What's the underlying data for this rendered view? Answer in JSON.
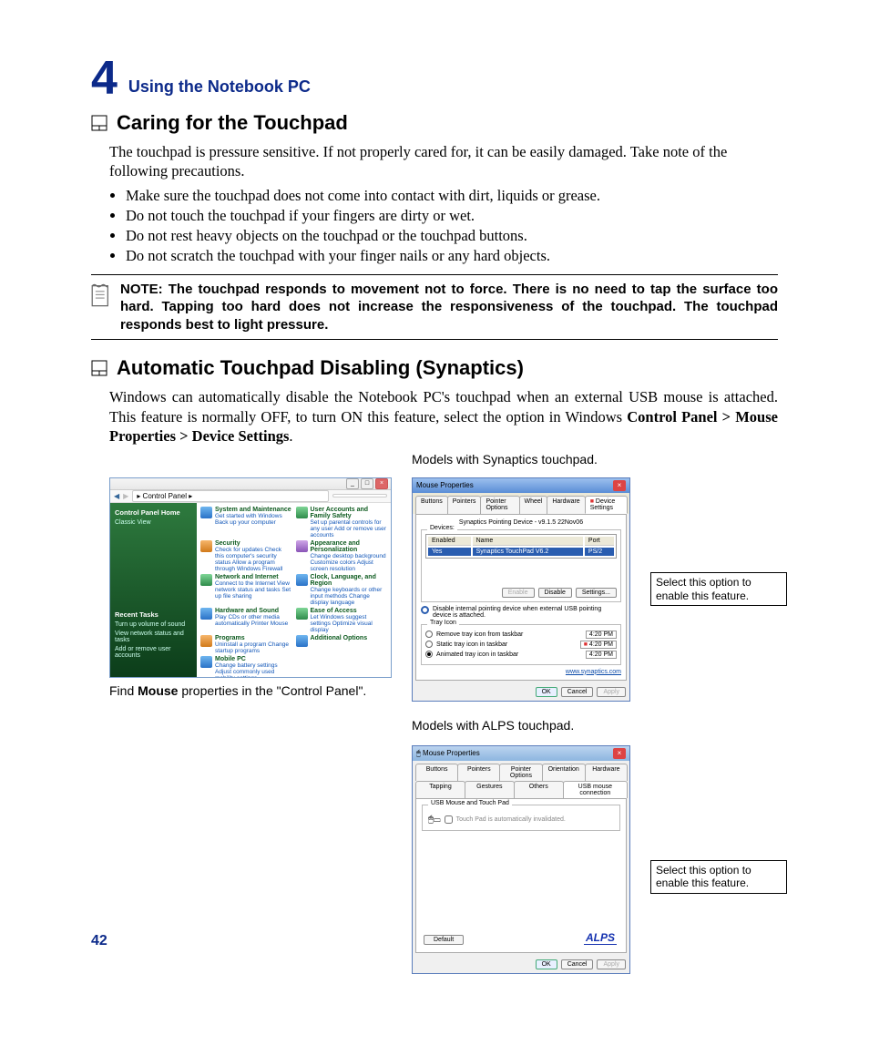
{
  "chapter": {
    "number": "4",
    "title": "Using the Notebook PC"
  },
  "page_number": "42",
  "section1": {
    "heading": "Caring for the Touchpad",
    "intro": "The touchpad is pressure sensitive. If not properly cared for, it can be easily damaged. Take note of the following precautions.",
    "bullets": [
      "Make sure the touchpad does not come into contact with dirt, liquids or grease.",
      "Do not touch the touchpad if your fingers are dirty or wet.",
      "Do not rest heavy objects on the touchpad or the touchpad buttons.",
      "Do not scratch the touchpad with your finger nails or any hard objects."
    ],
    "note": "NOTE:  The touchpad responds to movement not to force. There is no need to tap the surface too hard. Tapping too hard does not increase the responsiveness of the touchpad. The touchpad responds best to light pressure."
  },
  "section2": {
    "heading": "Automatic Touchpad Disabling (Synaptics)",
    "intro_a": "Windows can automatically disable the Notebook PC's touchpad when an external USB mouse is attached. This feature is normally OFF, to turn ON this feature, select the option in Windows ",
    "intro_b": "Control Panel > Mouse Properties > Device Settings",
    "cp_caption_a": "Find ",
    "cp_caption_b": "Mouse",
    "cp_caption_c": " properties in the \"Control Panel\".",
    "syn_caption": "Models with Synaptics touchpad.",
    "alps_caption": "Models with ALPS touchpad.",
    "callout": "Select this option to enable this feature."
  },
  "control_panel": {
    "breadcrumb": "▸ Control Panel ▸",
    "side_title": "Control Panel Home",
    "side_link": "Classic View",
    "side_heading2": "Recent Tasks",
    "side_tasks": [
      "Turn up volume of sound",
      "View network status and tasks",
      "Add or remove user accounts"
    ],
    "items": [
      {
        "title": "System and Maintenance",
        "sub": "Get started with Windows\nBack up your computer"
      },
      {
        "title": "User Accounts and Family Safety",
        "sub": "Set up parental controls for any user\nAdd or remove user accounts"
      },
      {
        "title": "Security",
        "sub": "Check for updates\nCheck this computer's security status\nAllow a program through Windows Firewall"
      },
      {
        "title": "Appearance and Personalization",
        "sub": "Change desktop background\nCustomize colors\nAdjust screen resolution"
      },
      {
        "title": "Network and Internet",
        "sub": "Connect to the Internet\nView network status and tasks\nSet up file sharing"
      },
      {
        "title": "Clock, Language, and Region",
        "sub": "Change keyboards or other input methods\nChange display language"
      },
      {
        "title": "Hardware and Sound",
        "sub": "Play CDs or other media automatically\nPrinter\nMouse"
      },
      {
        "title": "Ease of Access",
        "sub": "Let Windows suggest settings\nOptimize visual display"
      },
      {
        "title": "Programs",
        "sub": "Uninstall a program\nChange startup programs"
      },
      {
        "title": "Additional Options",
        "sub": ""
      },
      {
        "title": "Mobile PC",
        "sub": "Change battery settings\nAdjust commonly used mobility settings"
      }
    ]
  },
  "synaptics_dialog": {
    "title": "Mouse Properties",
    "tabs": [
      "Buttons",
      "Pointers",
      "Pointer Options",
      "Wheel",
      "Hardware",
      "Device Settings"
    ],
    "active_tab": "Device Settings",
    "version": "Synaptics Pointing Device - v9.1.5 22Nov06",
    "devices_label": "Devices:",
    "columns": {
      "enabled": "Enabled",
      "name": "Name",
      "port": "Port"
    },
    "device_row": {
      "enabled": "Yes",
      "name": "Synaptics TouchPad V6.2",
      "port": "PS/2"
    },
    "btn_enable": "Enable",
    "btn_disable": "Disable",
    "btn_settings": "Settings...",
    "checkbox": "Disable internal pointing device when external USB pointing device is attached.",
    "tray_label": "Tray Icon",
    "tray_options": [
      "Remove tray icon from taskbar",
      "Static tray icon in taskbar",
      "Animated tray icon in taskbar"
    ],
    "time": "4:20 PM",
    "link": "www.synaptics.com",
    "ok": "OK",
    "cancel": "Cancel",
    "apply": "Apply"
  },
  "alps_dialog": {
    "title": "Mouse Properties",
    "tabs_row1": [
      "Buttons",
      "Pointers",
      "Pointer Options",
      "Orientation",
      "Hardware"
    ],
    "tabs_row2": [
      "Tapping",
      "Gestures",
      "Others",
      "USB mouse connection"
    ],
    "active_tab": "USB mouse connection",
    "group": "USB Mouse and Touch Pad",
    "check_text": "Touch Pad is automatically invalidated.",
    "logo": "ALPS",
    "default": "Default",
    "ok": "OK",
    "cancel": "Cancel",
    "apply": "Apply"
  }
}
